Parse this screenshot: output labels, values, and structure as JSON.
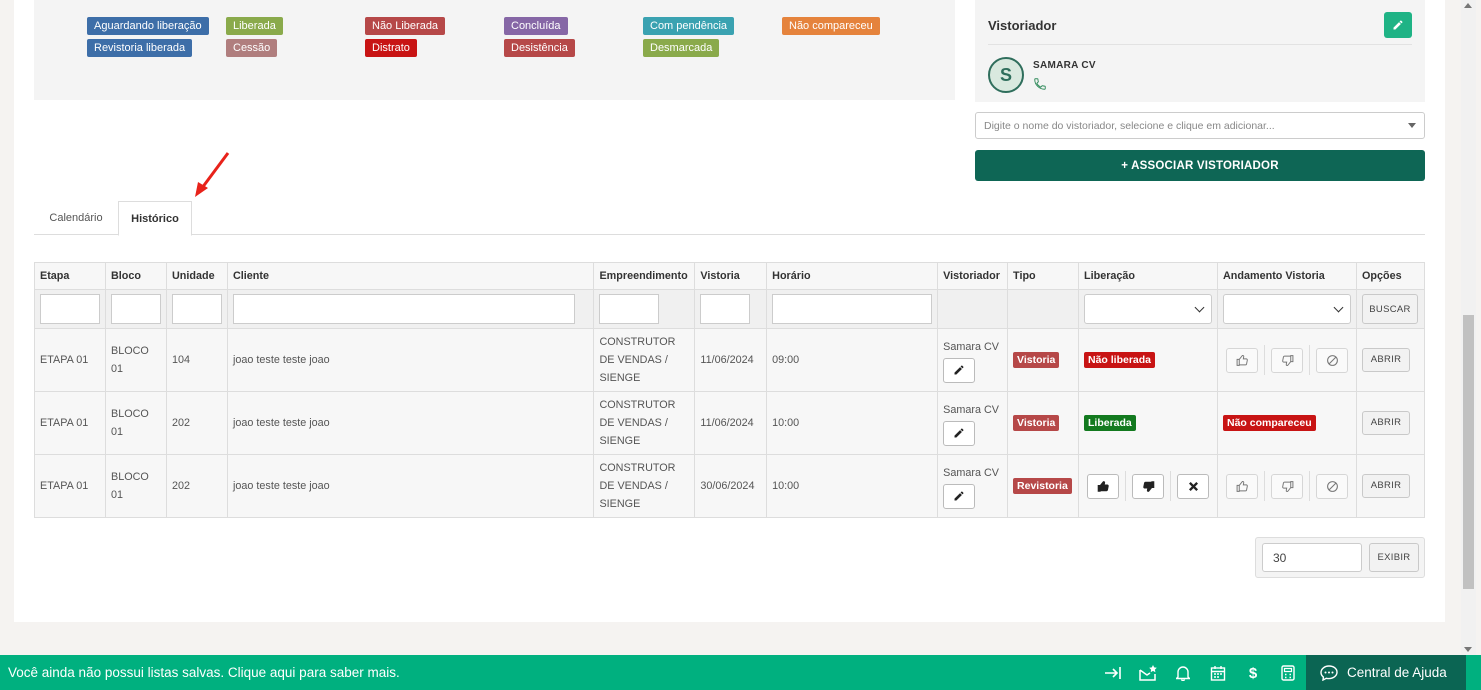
{
  "legend": [
    {
      "label": "Aguardando liberação",
      "color": "#3d6ea8"
    },
    {
      "label": "Liberada",
      "color": "#8aaa4b"
    },
    {
      "label": "Não Liberada",
      "color": "#b64848"
    },
    {
      "label": "Concluída",
      "color": "#8667a6"
    },
    {
      "label": "Com pendência",
      "color": "#3aa2b1"
    },
    {
      "label": "Não compareceu",
      "color": "#e5833c"
    },
    {
      "label": "Revistoria liberada",
      "color": "#3d6ea8"
    },
    {
      "label": "Cessão",
      "color": "#b07e7e"
    },
    {
      "label": "Distrato",
      "color": "#c81414"
    },
    {
      "label": "Desistência",
      "color": "#b64848"
    },
    {
      "label": "Desmarcada",
      "color": "#8aaa4b"
    }
  ],
  "vistoriador": {
    "title": "Vistoriador",
    "avatar_letter": "S",
    "name": "SAMARA CV",
    "select_placeholder": "Digite o nome do vistoriador, selecione e clique em adicionar...",
    "assoc_button": "+ ASSOCIAR VISTORIADOR"
  },
  "tabs": {
    "calendario": "Calendário",
    "historico": "Histórico"
  },
  "table": {
    "headers": [
      "Etapa",
      "Bloco",
      "Unidade",
      "Cliente",
      "Empreendimento",
      "Vistoria",
      "Horário",
      "Vistoriador",
      "Tipo",
      "Liberação",
      "Andamento Vistoria",
      "Opções"
    ],
    "buscar": "BUSCAR",
    "abrir": "ABRIR",
    "rows": [
      {
        "etapa": "ETAPA 01",
        "bloco": "BLOCO 01",
        "unidade": "104",
        "cliente": "joao teste teste joao",
        "empreendimento": "CONSTRUTOR DE VENDAS / SIENGE",
        "vistoria": "11/06/2024",
        "horario": "09:00",
        "vistoriador": "Samara CV",
        "tipo": "Vistoria",
        "liberacao": "Não liberada",
        "andamento": ""
      },
      {
        "etapa": "ETAPA 01",
        "bloco": "BLOCO 01",
        "unidade": "202",
        "cliente": "joao teste teste joao",
        "empreendimento": "CONSTRUTOR DE VENDAS / SIENGE",
        "vistoria": "11/06/2024",
        "horario": "10:00",
        "vistoriador": "Samara CV",
        "tipo": "Vistoria",
        "liberacao": "Liberada",
        "andamento": "Não compareceu"
      },
      {
        "etapa": "ETAPA 01",
        "bloco": "BLOCO 01",
        "unidade": "202",
        "cliente": "joao teste teste joao",
        "empreendimento": "CONSTRUTOR DE VENDAS / SIENGE",
        "vistoria": "30/06/2024",
        "horario": "10:00",
        "vistoriador": "Samara CV",
        "tipo": "Revistoria",
        "liberacao": "",
        "andamento": ""
      }
    ]
  },
  "pager": {
    "value": "30",
    "button": "EXIBIR"
  },
  "footer": {
    "message": "Você ainda não possui listas salvas. Clique aqui para saber mais.",
    "help": "Central de Ajuda"
  },
  "colors": {
    "tag_red": "#b64848",
    "tag_dark_red": "#c81414",
    "tag_green": "#137a1f",
    "brand": "#00b07f",
    "brand_dark": "#0b6553"
  }
}
